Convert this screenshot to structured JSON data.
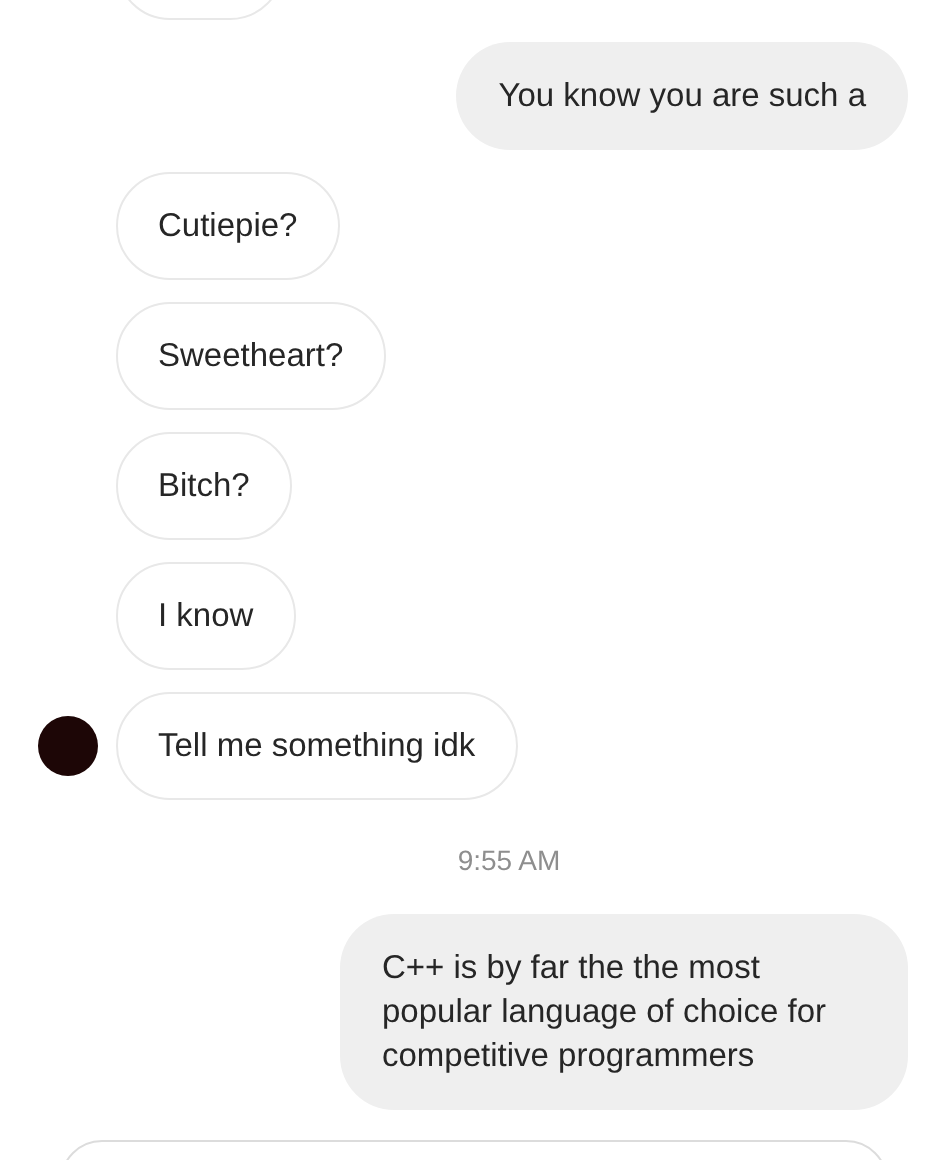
{
  "messages": [
    {
      "kind": "received",
      "avatar": false
    },
    {
      "kind": "sent",
      "text": "You know you are such a"
    },
    {
      "kind": "received",
      "text": "Cutiepie?",
      "avatar": false
    },
    {
      "kind": "received",
      "text": "Sweetheart?",
      "avatar": false
    },
    {
      "kind": "received",
      "text": "Bitch?",
      "avatar": false
    },
    {
      "kind": "received",
      "text": "I know",
      "avatar": false
    },
    {
      "kind": "received",
      "text": "Tell me something idk",
      "avatar": true
    },
    {
      "kind": "time",
      "text": "9:55 AM"
    },
    {
      "kind": "sent",
      "text": "C++ is by far the the most popular language of choice for competitive programmers"
    }
  ],
  "message_field": {
    "shown": true
  }
}
